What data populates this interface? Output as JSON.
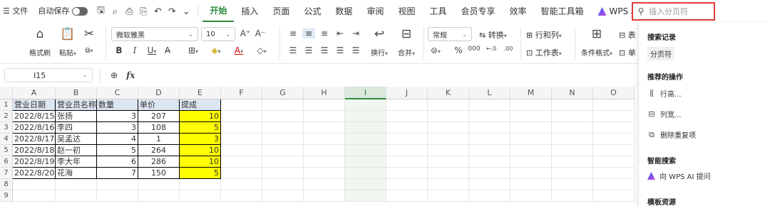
{
  "menubar": {
    "file_label": "☰ 文件",
    "autosave_label": "自动保存",
    "tabs": [
      "开始",
      "插入",
      "页面",
      "公式",
      "数据",
      "审阅",
      "视图",
      "工具",
      "会员专享",
      "效率",
      "智能工具箱"
    ],
    "active_tab": "开始",
    "wps_ai_label": "WPS AI",
    "search_placeholder": "插入分页符"
  },
  "ribbon": {
    "format_painter": "格式刷",
    "paste": "粘贴",
    "font_name": "微软雅黑",
    "font_size": "10",
    "number_format": "常规",
    "convert": "转换",
    "rows_cols": "行和列",
    "wrap": "换行",
    "merge": "合并",
    "worksheet": "工作表",
    "cond_format": "条件格式",
    "single": "单",
    "table_style": "表"
  },
  "formula_bar": {
    "cell_ref": "I15",
    "formula": ""
  },
  "grid": {
    "columns": [
      "A",
      "B",
      "C",
      "D",
      "E",
      "F",
      "G",
      "H",
      "I",
      "J",
      "K",
      "L",
      "M",
      "N",
      "O"
    ],
    "selected_column": "I",
    "row_numbers": [
      "1",
      "2",
      "3",
      "4",
      "5",
      "6",
      "7",
      "8",
      "9"
    ],
    "headers": [
      "营业日期",
      "营业员名称",
      "数量",
      "单价",
      "提成"
    ],
    "rows": [
      [
        "2022/8/15",
        "张扬",
        "3",
        "207",
        "10"
      ],
      [
        "2022/8/16",
        "李四",
        "3",
        "108",
        "5"
      ],
      [
        "2022/8/17",
        "吴孟达",
        "4",
        "1",
        "3"
      ],
      [
        "2022/8/18",
        "赵一初",
        "5",
        "264",
        "10"
      ],
      [
        "2022/8/19",
        "李大年",
        "6",
        "286",
        "10"
      ],
      [
        "2022/8/20",
        "花海",
        "7",
        "150",
        "5"
      ]
    ]
  },
  "panel": {
    "history_title": "搜索记录",
    "history_tag": "分页符",
    "recommended_title": "推荐的操作",
    "actions": [
      "行高...",
      "列宽...",
      "删除重复项"
    ],
    "smart_search_title": "智能搜索",
    "ask_ai": "向 WPS AI 提问",
    "template_title": "模板资源"
  },
  "colors": {
    "accent": "#2e8b3d",
    "highlight_yellow": "#ffff00",
    "header_blue": "#dce6f1",
    "search_border": "#e03b3b"
  }
}
